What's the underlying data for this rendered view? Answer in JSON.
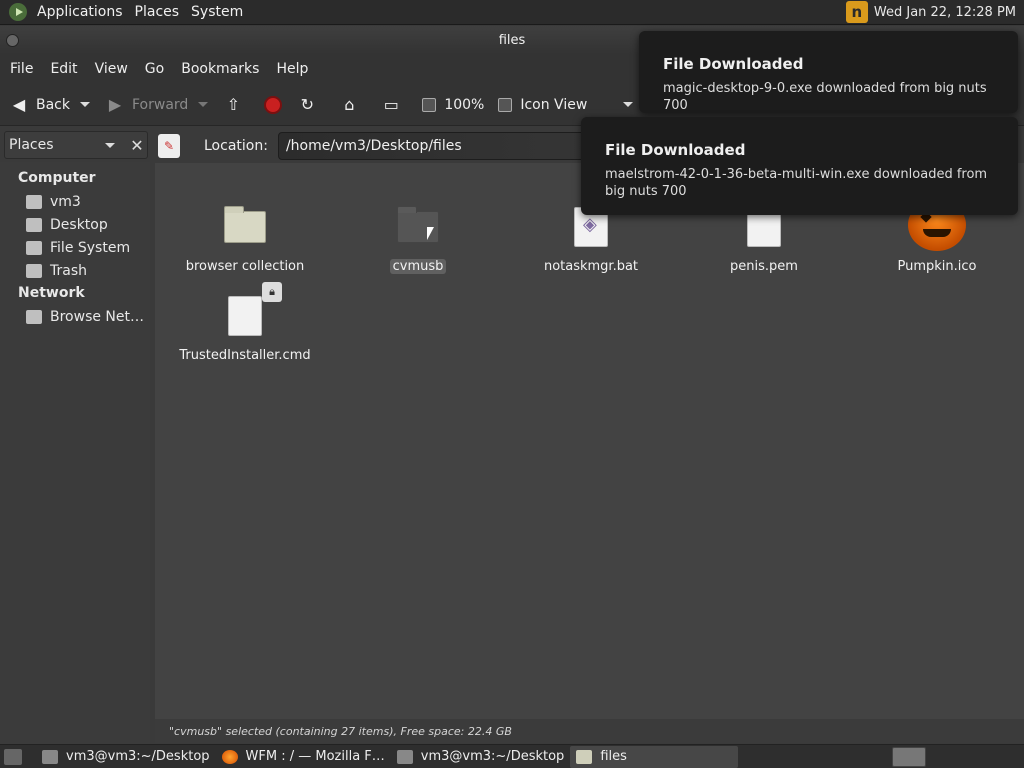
{
  "top_panel": {
    "menus": [
      "Applications",
      "Places",
      "System"
    ],
    "clock": "Wed Jan 22, 12:28 PM"
  },
  "window": {
    "title": "files"
  },
  "menubar": [
    "File",
    "Edit",
    "View",
    "Go",
    "Bookmarks",
    "Help"
  ],
  "toolbar": {
    "back": "Back",
    "forward": "Forward",
    "zoom": "100%",
    "view_mode": "Icon View"
  },
  "sidebar": {
    "selector": "Places",
    "sections": [
      {
        "heading": "Computer",
        "items": [
          "vm3",
          "Desktop",
          "File System",
          "Trash"
        ]
      },
      {
        "heading": "Network",
        "items": [
          "Browse Net…"
        ]
      }
    ]
  },
  "location": {
    "label": "Location:",
    "path": "/home/vm3/Desktop/files"
  },
  "files": [
    {
      "name": "browser collection",
      "type": "folder"
    },
    {
      "name": "cvmusb",
      "type": "folder",
      "selected": true
    },
    {
      "name": "notaskmgr.bat",
      "type": "script"
    },
    {
      "name": "penis.pem",
      "type": "document"
    },
    {
      "name": "Pumpkin.ico",
      "type": "image"
    },
    {
      "name": "TrustedInstaller.cmd",
      "type": "document",
      "locked": true
    }
  ],
  "statusbar": "\"cvmusb\" selected (containing 27 items), Free space: 22.4 GB",
  "notifications": [
    {
      "title": "File Downloaded",
      "body": "magic-desktop-9-0.exe downloaded from big nuts 700"
    },
    {
      "title": "File Downloaded",
      "body": "maelstrom-42-0-1-36-beta-multi-win.exe downloaded from big nuts 700"
    }
  ],
  "taskbar": [
    {
      "label": "vm3@vm3:~/Desktop",
      "icon": "terminal-icon"
    },
    {
      "label": "WFM : / — Mozilla F…",
      "icon": "firefox-icon"
    },
    {
      "label": "vm3@vm3:~/Desktop",
      "icon": "terminal-icon"
    },
    {
      "label": "files",
      "icon": "folder-icon",
      "active": true
    }
  ]
}
